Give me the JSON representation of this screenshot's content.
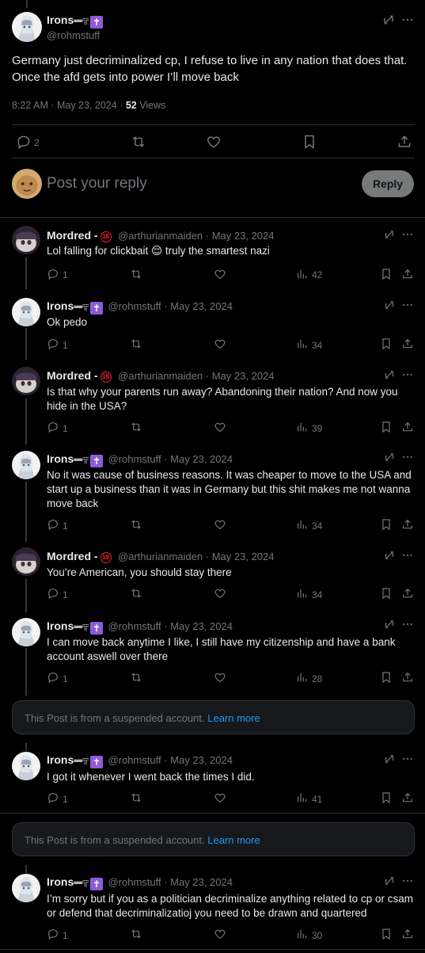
{
  "main_post": {
    "display_name": "Irons",
    "handle": "@rohmstuff",
    "text": "Germany just decriminalized cp, I refuse to live in any nation that does that. Once the afd gets into power I’ll move back",
    "time": "8:22 AM · May 23, 2024 · ",
    "views_count": "52",
    "views_label": " Views",
    "replies": "2"
  },
  "composer": {
    "placeholder": "Post your reply",
    "reply_label": "Reply"
  },
  "replies": [
    {
      "display_name": "Mordred -",
      "handle": "@arthurianmaiden · May 23, 2024",
      "line1": "Lol falling for clickbait 😌 truly the smartest nazi",
      "line2": "",
      "line3": "",
      "replies": "1",
      "views": "42"
    },
    {
      "display_name": "Irons",
      "handle": "@rohmstuff · May 23, 2024",
      "line1": "Ok pedo",
      "line2": "",
      "line3": "",
      "replies": "1",
      "views": "34"
    },
    {
      "display_name": "Mordred -",
      "handle": "@arthurianmaiden · May 23, 2024",
      "line1": "Is that why your parents run away? Abandoning their nation? And now you",
      "line2": "hide in the USA?",
      "line3": "",
      "replies": "1",
      "views": "39"
    },
    {
      "display_name": "Irons",
      "handle": "@rohmstuff · May 23, 2024",
      "line1": "No it was cause of business reasons. It was cheaper to move to the USA and",
      "line2": "start up a business than it was in Germany but this shit makes me not wanna",
      "line3": "move back",
      "replies": "1",
      "views": "34"
    },
    {
      "display_name": "Mordred -",
      "handle": "@arthurianmaiden · May 23, 2024",
      "line1": "You’re American, you should stay there",
      "line2": "",
      "line3": "",
      "replies": "1",
      "views": "34"
    },
    {
      "display_name": "Irons",
      "handle": "@rohmstuff · May 23, 2024",
      "line1": "I can move back anytime I like, I still have my citizenship and have a bank",
      "line2": "account aswell over there",
      "line3": "",
      "replies": "1",
      "views": "28"
    },
    {
      "display_name": "Irons",
      "handle": "@rohmstuff · May 23, 2024",
      "line1": "I got it whenever I went back the times I did.",
      "line2": "",
      "line3": "",
      "replies": "1",
      "views": "41"
    },
    {
      "display_name": "Irons",
      "handle": "@rohmstuff · May 23, 2024",
      "line1": "I’m sorry but if you as a politician decriminalize anything related to cp or csam",
      "line2": "or defend that decriminalizatioj you need to be drawn and quartered",
      "line3": "",
      "replies": "1",
      "views": "30"
    }
  ],
  "suspended": {
    "text": "This Post is from a suspended account. ",
    "link": "Learn more"
  },
  "badges": {
    "age": "18"
  },
  "colors": {
    "background": "#000000",
    "text": "#e7e9ea",
    "muted": "#71767b",
    "link": "#1d9bf0",
    "badge_red": "#f4212e",
    "badge_purple": "#8e5bd8"
  }
}
